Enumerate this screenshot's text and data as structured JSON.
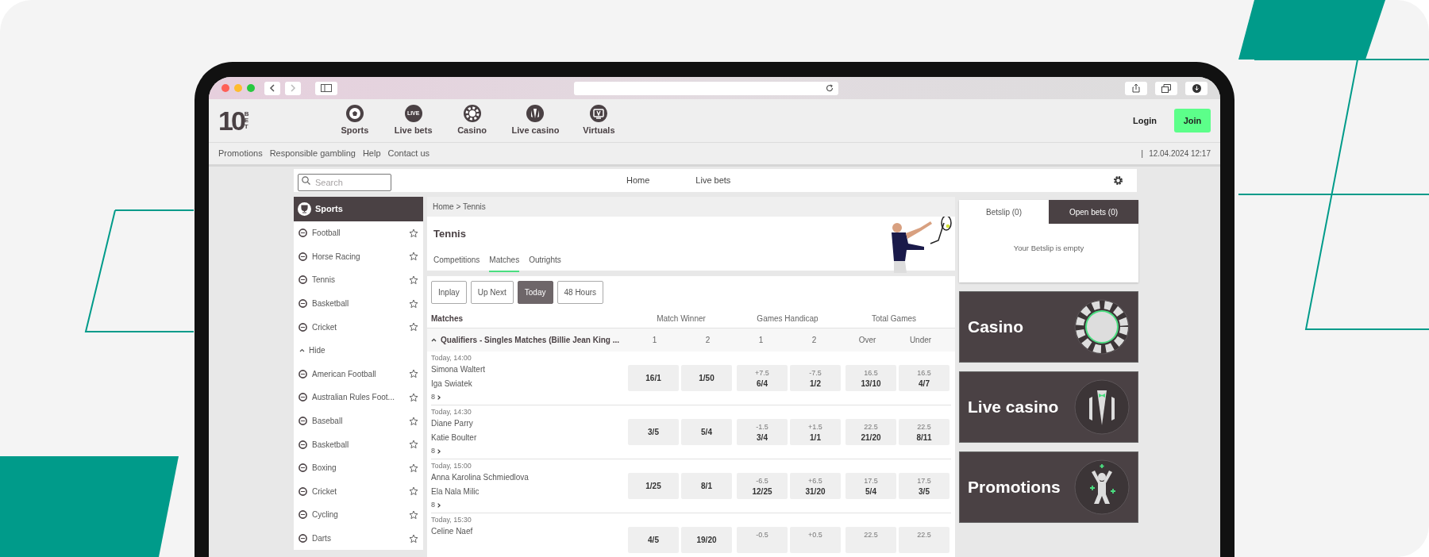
{
  "header": {
    "logo": {
      "number": "10",
      "word": "BET"
    },
    "nav": [
      {
        "label": "Sports",
        "kind": "ball"
      },
      {
        "label": "Live bets",
        "kind": "live",
        "icon_text": "LIVE"
      },
      {
        "label": "Casino",
        "kind": "chip"
      },
      {
        "label": "Live casino",
        "kind": "suit"
      },
      {
        "label": "Virtuals",
        "kind": "tv"
      }
    ],
    "login": "Login",
    "join": "Join"
  },
  "subnav": {
    "links": [
      "Promotions",
      "Responsible gambling",
      "Help",
      "Contact us"
    ],
    "separator": "|",
    "datetime": "12.04.2024 12:17"
  },
  "topbar": {
    "search_placeholder": "Search",
    "links": [
      "Home",
      "Live bets"
    ]
  },
  "sidebar": {
    "title": "Sports",
    "items": [
      {
        "kind": "sport",
        "label": "Football"
      },
      {
        "kind": "sport",
        "label": "Horse Racing"
      },
      {
        "kind": "sport",
        "label": "Tennis"
      },
      {
        "kind": "sport",
        "label": "Basketball"
      },
      {
        "kind": "sport",
        "label": "Cricket"
      },
      {
        "kind": "toggle",
        "label": "Hide"
      },
      {
        "kind": "sport",
        "label": "American Football"
      },
      {
        "kind": "sport",
        "label": "Australian Rules Foot..."
      },
      {
        "kind": "sport",
        "label": "Baseball"
      },
      {
        "kind": "sport",
        "label": "Basketball"
      },
      {
        "kind": "sport",
        "label": "Boxing"
      },
      {
        "kind": "sport",
        "label": "Cricket"
      },
      {
        "kind": "sport",
        "label": "Cycling"
      },
      {
        "kind": "sport",
        "label": "Darts"
      }
    ]
  },
  "breadcrumb": "Home > Tennis",
  "title": "Tennis",
  "tabs": [
    {
      "label": "Competitions",
      "selected": false
    },
    {
      "label": "Matches",
      "selected": true
    },
    {
      "label": "Outrights",
      "selected": false
    }
  ],
  "filters": [
    {
      "label": "Inplay",
      "selected": false
    },
    {
      "label": "Up Next",
      "selected": false
    },
    {
      "label": "Today",
      "selected": true
    },
    {
      "label": "48 Hours",
      "selected": false
    }
  ],
  "table": {
    "first_column": "Matches",
    "markets": [
      {
        "label": "Match Winner",
        "outcomes": [
          "1",
          "2"
        ]
      },
      {
        "label": "Games Handicap",
        "outcomes": [
          "1",
          "2"
        ]
      },
      {
        "label": "Total Games",
        "outcomes": [
          "Over",
          "Under"
        ]
      }
    ],
    "group": {
      "label": "Qualifiers - Singles Matches (Billie Jean King ...",
      "expanded": true
    },
    "matches": [
      {
        "time": "Today, 14:00",
        "home": "Simona Waltert",
        "away": "Iga Swiatek",
        "more": "8",
        "odds": [
          {
            "price": "16/1"
          },
          {
            "price": "1/50"
          },
          {
            "line": "+7.5",
            "price": "6/4"
          },
          {
            "line": "-7.5",
            "price": "1/2"
          },
          {
            "line": "16.5",
            "price": "13/10"
          },
          {
            "line": "16.5",
            "price": "4/7"
          }
        ]
      },
      {
        "time": "Today, 14:30",
        "home": "Diane Parry",
        "away": "Katie Boulter",
        "more": "8",
        "odds": [
          {
            "price": "3/5"
          },
          {
            "price": "5/4"
          },
          {
            "line": "-1.5",
            "price": "3/4"
          },
          {
            "line": "+1.5",
            "price": "1/1"
          },
          {
            "line": "22.5",
            "price": "21/20"
          },
          {
            "line": "22.5",
            "price": "8/11"
          }
        ]
      },
      {
        "time": "Today, 15:00",
        "home": "Anna Karolina Schmiedlova",
        "away": "Ela Nala Milic",
        "more": "8",
        "odds": [
          {
            "price": "1/25"
          },
          {
            "price": "8/1"
          },
          {
            "line": "-6.5",
            "price": "12/25"
          },
          {
            "line": "+6.5",
            "price": "31/20"
          },
          {
            "line": "17.5",
            "price": "5/4"
          },
          {
            "line": "17.5",
            "price": "3/5"
          }
        ]
      },
      {
        "time": "Today, 15:30",
        "home": "Celine Naef",
        "odds": [
          {
            "price": "4/5"
          },
          {
            "price": "19/20"
          },
          {
            "line": "-0.5"
          },
          {
            "line": "+0.5"
          },
          {
            "line": "22.5"
          },
          {
            "line": "22.5"
          }
        ]
      }
    ]
  },
  "betslip": {
    "tabs": [
      {
        "label": "Betslip (0)",
        "selected": true
      },
      {
        "label": "Open bets (0)",
        "selected": false
      }
    ],
    "empty": "Your Betslip is empty"
  },
  "promos": [
    {
      "label": "Casino",
      "kind": "chip"
    },
    {
      "label": "Live casino",
      "kind": "suit"
    },
    {
      "label": "Promotions",
      "kind": "star"
    }
  ]
}
